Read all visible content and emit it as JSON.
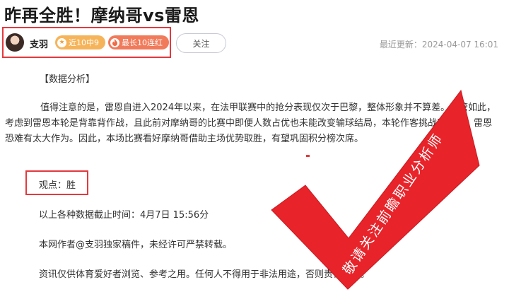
{
  "article": {
    "title": "昨再全胜！摩纳哥vs雷恩",
    "section_heading": "【数据分析】",
    "body_paragraph": "值得注意的是，雷恩自进入2024年以来，在法甲联赛中的抢分表现仅次于巴黎，整体形象并不算差。尽管如此，考虑到雷恩本轮是背靠背作战，且此前对摩纳哥的比赛中即便人数占优也未能改变输球结局，本轮作客挑战摩纳哥，雷恩恐难有太大作为。因此，本场比赛看好摩纳哥借助主场优势取胜，有望巩固积分榜次席。",
    "opinion": "观点：胜",
    "data_cutoff": "以上各种数据截止时间：4月7日 15:56分",
    "copyright": "本网作者@支羽独家稿件，未经许可严禁转载。",
    "disclaimer": "资讯仅供体育爱好者浏览、参考之用。任何人不得用于非法用途，否则责任自负。"
  },
  "author": {
    "name": "支羽",
    "badges": [
      {
        "label": "近10中9",
        "icon": "star-icon"
      },
      {
        "label": "最长10连红",
        "icon": "flame-icon"
      }
    ],
    "follow_label": "关注"
  },
  "meta": {
    "updated": "最近更新：2024-04-07 16:01"
  },
  "watermark": {
    "text": "敬请关注前瞻职业分析师",
    "color": "#e8232a"
  },
  "colors": {
    "highlight_border": "#e4393c",
    "badge_win": "#f6b45a",
    "badge_streak": "#f07a5a"
  }
}
